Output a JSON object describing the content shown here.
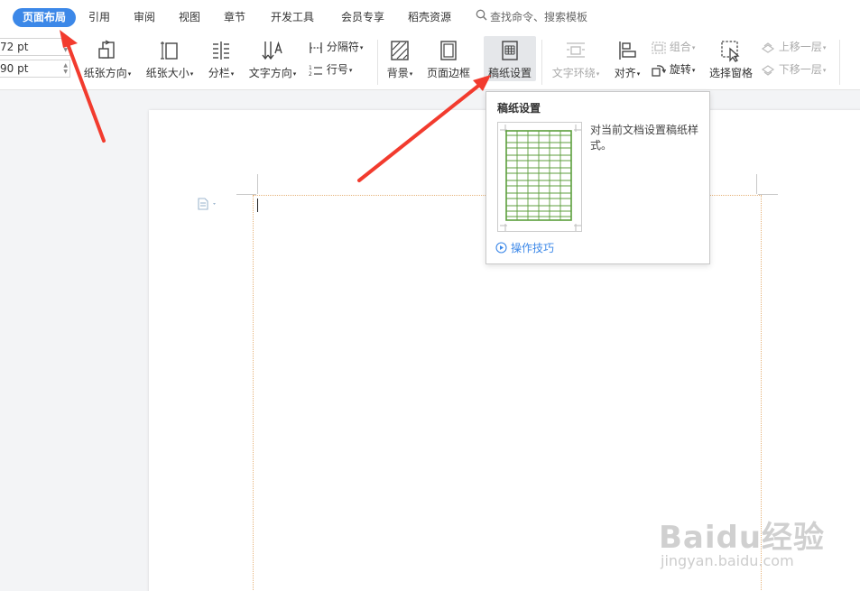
{
  "tabs": [
    {
      "label": "页面布局",
      "active": true
    },
    {
      "label": "引用"
    },
    {
      "label": "审阅"
    },
    {
      "label": "视图"
    },
    {
      "label": "章节"
    },
    {
      "label": "开发工具"
    },
    {
      "label": "会员专享"
    },
    {
      "label": "稻壳资源"
    }
  ],
  "search": {
    "placeholder": "查找命令、搜索模板"
  },
  "ribbon": {
    "font_size_1": "72 pt",
    "font_size_2": "90 pt",
    "paper_orientation": "纸张方向",
    "paper_size": "纸张大小",
    "columns": "分栏",
    "text_direction": "文字方向",
    "separator": "分隔符",
    "line_number": "行号",
    "background": "背景",
    "page_border": "页面边框",
    "manuscript_settings": "稿纸设置",
    "text_wrap": "文字环绕",
    "align": "对齐",
    "group": "组合",
    "rotate": "旋转",
    "selection_pane": "选择窗格",
    "bring_forward": "上移一层",
    "send_backward": "下移一层"
  },
  "tooltip": {
    "title": "稿纸设置",
    "description": "对当前文档设置稿纸样式。",
    "link": "操作技巧"
  },
  "watermark": {
    "brand": "Baidu经验",
    "url": "jingyan.baidu.com"
  },
  "colors": {
    "accent": "#3c88e8",
    "arrow": "#f23b2e",
    "grid_green": "#5c9e3c"
  }
}
